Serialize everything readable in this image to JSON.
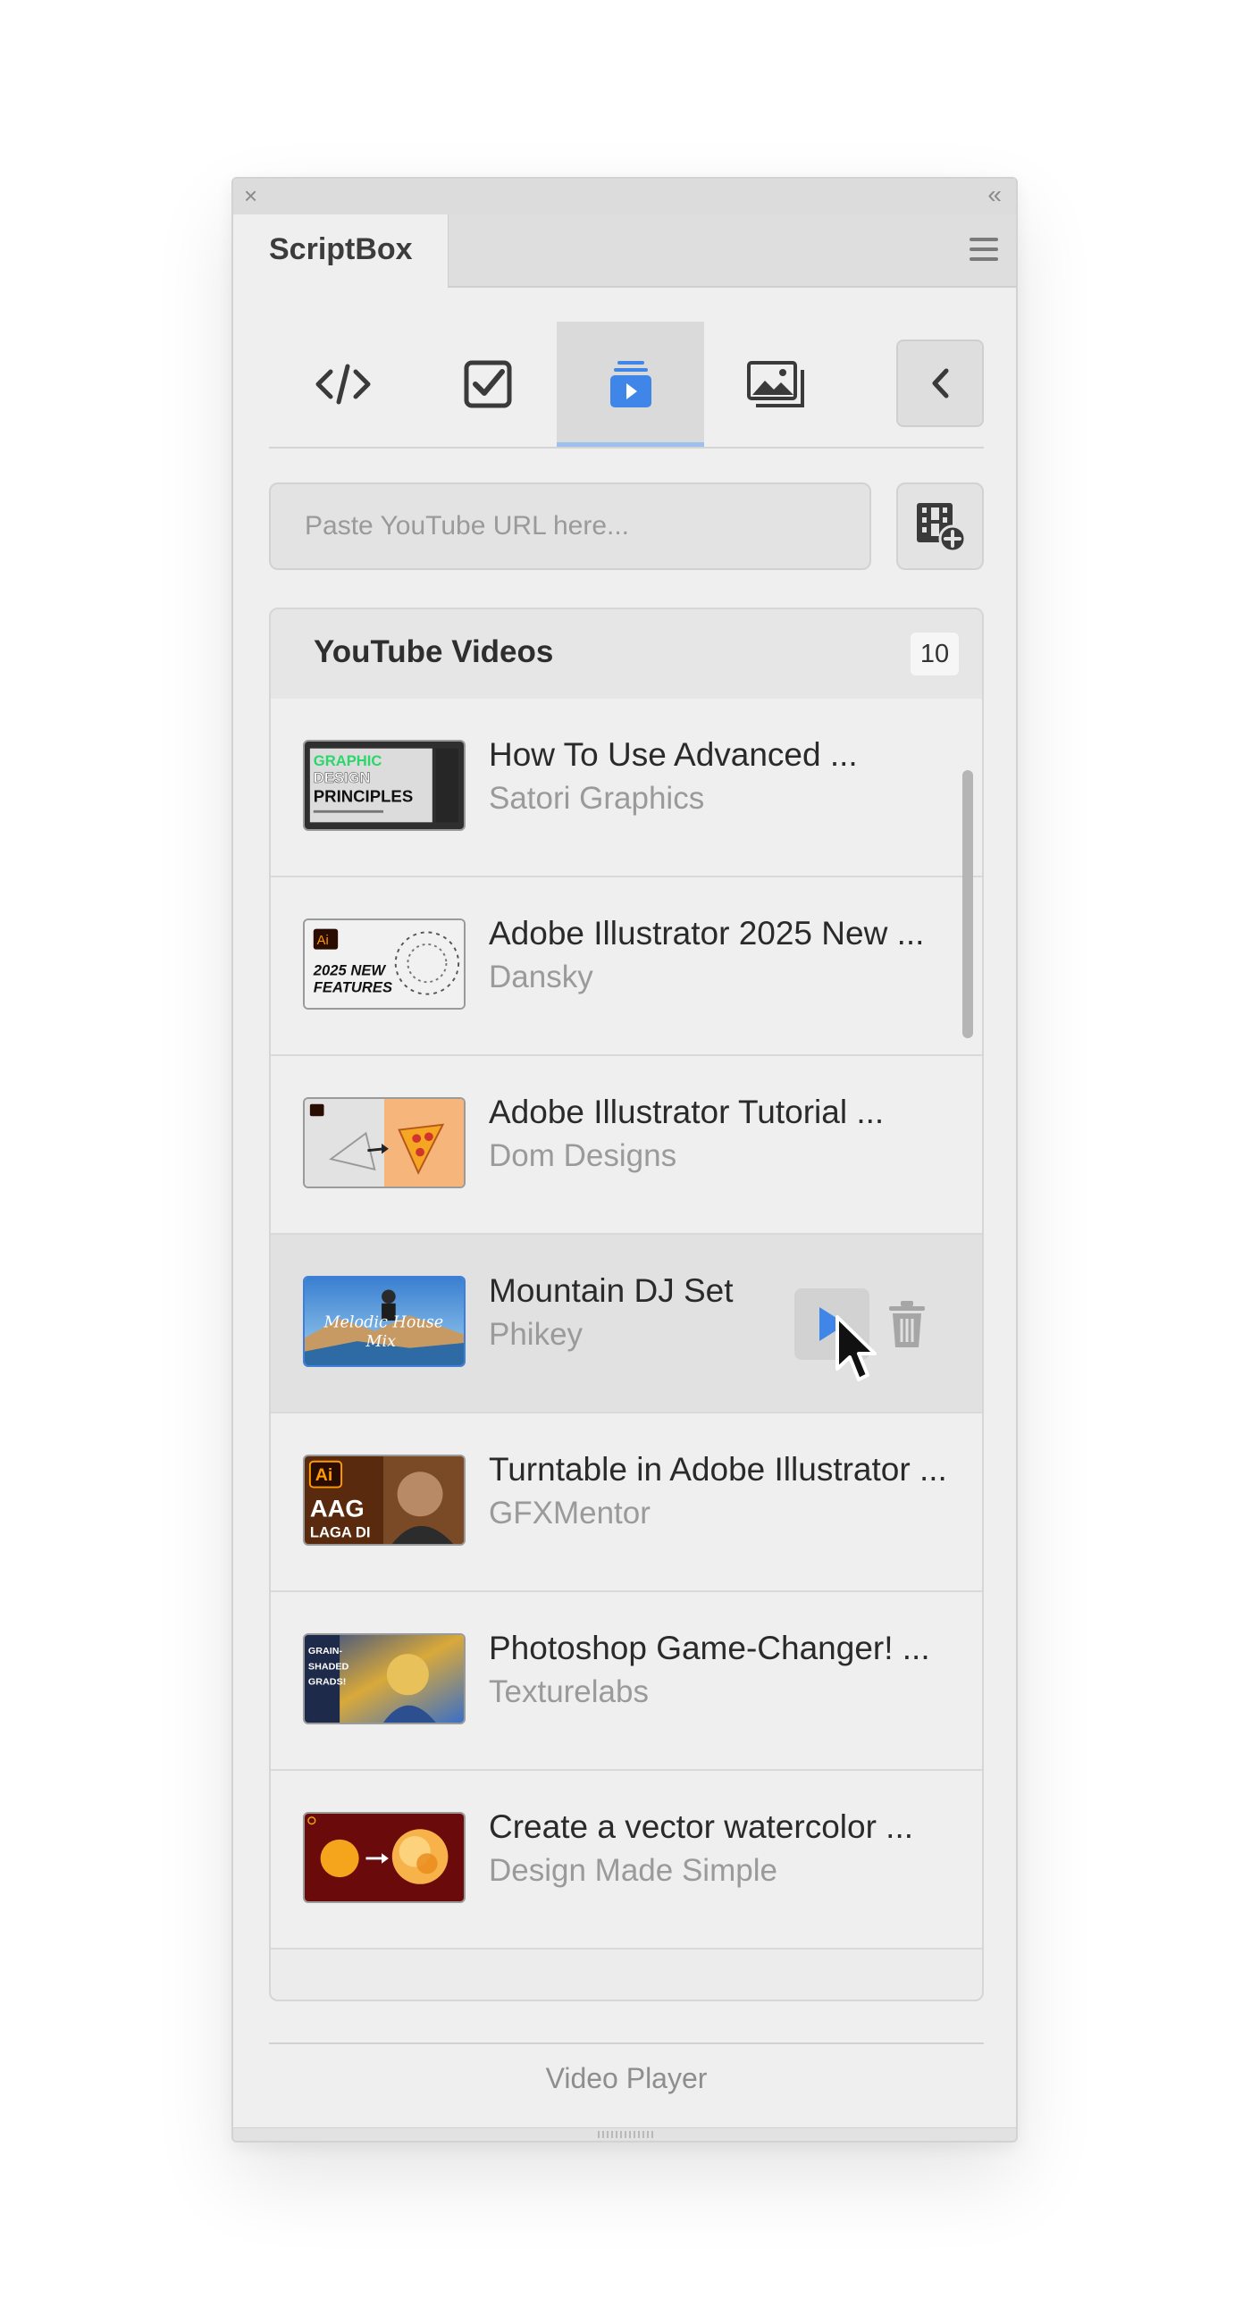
{
  "window": {
    "close_glyph": "×",
    "collapse_glyph": "«",
    "panel_tab": "ScriptBox"
  },
  "toolbar": {
    "tools": [
      {
        "name": "code-icon",
        "active": false
      },
      {
        "name": "checkbox-icon",
        "active": false
      },
      {
        "name": "video-stack-icon",
        "active": true
      },
      {
        "name": "image-icon",
        "active": false
      }
    ],
    "back_icon": "chevron-left-icon"
  },
  "url_input": {
    "placeholder": "Paste YouTube URL here...",
    "value": ""
  },
  "add_button_icon": "film-add-icon",
  "videos": {
    "title": "YouTube Videos",
    "count": "10",
    "items": [
      {
        "title": "How To Use Advanced ...",
        "author": "Satori Graphics",
        "thumb_text": "GRAPHIC DESIGN PRINCIPLES"
      },
      {
        "title": "Adobe Illustrator 2025 New ...",
        "author": "Dansky",
        "thumb_text": "2025 NEW FEATURES"
      },
      {
        "title": "Adobe Illustrator Tutorial ...",
        "author": "Dom Designs",
        "thumb_text": ""
      },
      {
        "title": "Mountain DJ Set",
        "author": "Phikey",
        "thumb_text": "Melodic House Mix",
        "hovered": true
      },
      {
        "title": "Turntable in Adobe Illustrator ...",
        "author": "GFXMentor",
        "thumb_text": "AAG LAGA DI"
      },
      {
        "title": "Photoshop Game-Changer! ...",
        "author": "Texturelabs",
        "thumb_text": "GRAIN-SHADED GRADS!"
      },
      {
        "title": "Create a vector watercolor ...",
        "author": "Design Made Simple",
        "thumb_text": ""
      }
    ]
  },
  "footer": {
    "label": "Video Player"
  },
  "colors": {
    "accent": "#3f86e8",
    "active_underline": "#9cc1ef"
  }
}
